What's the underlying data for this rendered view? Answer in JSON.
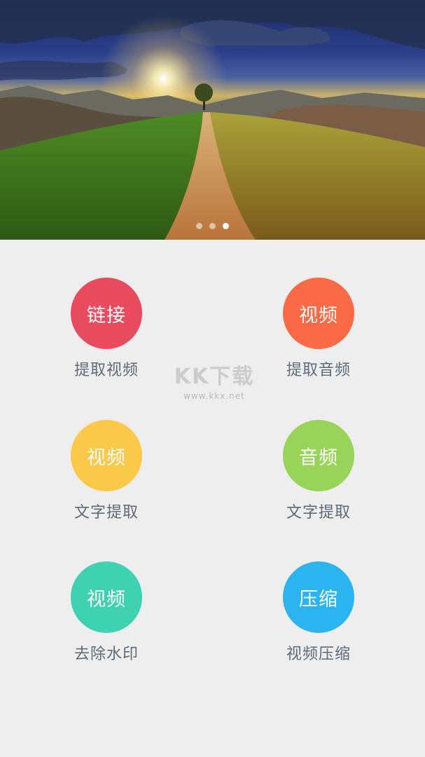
{
  "banner": {
    "image": "landscape-road-sunset",
    "indicator": {
      "count": 3,
      "active_index": 2
    }
  },
  "tools": [
    {
      "icon_text": "链接",
      "label": "提取视频",
      "color": "#e94b5e"
    },
    {
      "icon_text": "视频",
      "label": "提取音频",
      "color": "#fb6a46"
    },
    {
      "icon_text": "视频",
      "label": "文字提取",
      "color": "#fbc94a"
    },
    {
      "icon_text": "音频",
      "label": "文字提取",
      "color": "#99d45a"
    },
    {
      "icon_text": "视频",
      "label": "去除水印",
      "color": "#3fd2b0"
    },
    {
      "icon_text": "压缩",
      "label": "视频压缩",
      "color": "#2cb4f0"
    }
  ],
  "watermark": {
    "title": "KK下载",
    "url": "www.kkx.net"
  }
}
